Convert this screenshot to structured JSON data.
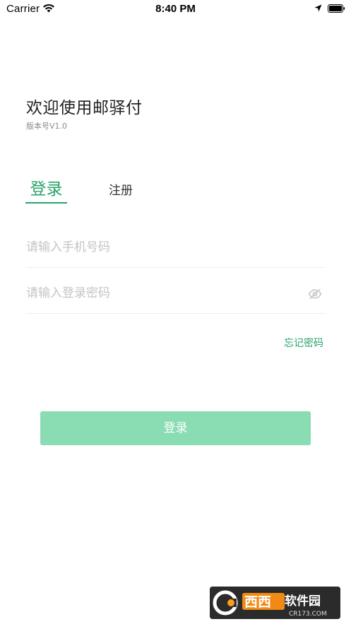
{
  "status_bar": {
    "carrier": "Carrier",
    "time": "8:40 PM"
  },
  "header": {
    "welcome": "欢迎使用邮驿付",
    "version": "版本号V1.0"
  },
  "tabs": {
    "login": "登录",
    "register": "注册"
  },
  "form": {
    "phone_placeholder": "请输入手机号码",
    "password_placeholder": "请输入登录密码",
    "forgot_password": "忘记密码",
    "login_button": "登录"
  },
  "watermark": {
    "brand": "西西软件园",
    "domain": "CR173.COM"
  },
  "colors": {
    "accent": "#27a36a",
    "button": "#8adcb2",
    "placeholder": "#c4c4c4"
  },
  "icons": {
    "wifi": "wifi-icon",
    "location": "location-arrow-icon",
    "battery": "battery-icon",
    "password_visibility": "eye-off-icon"
  }
}
